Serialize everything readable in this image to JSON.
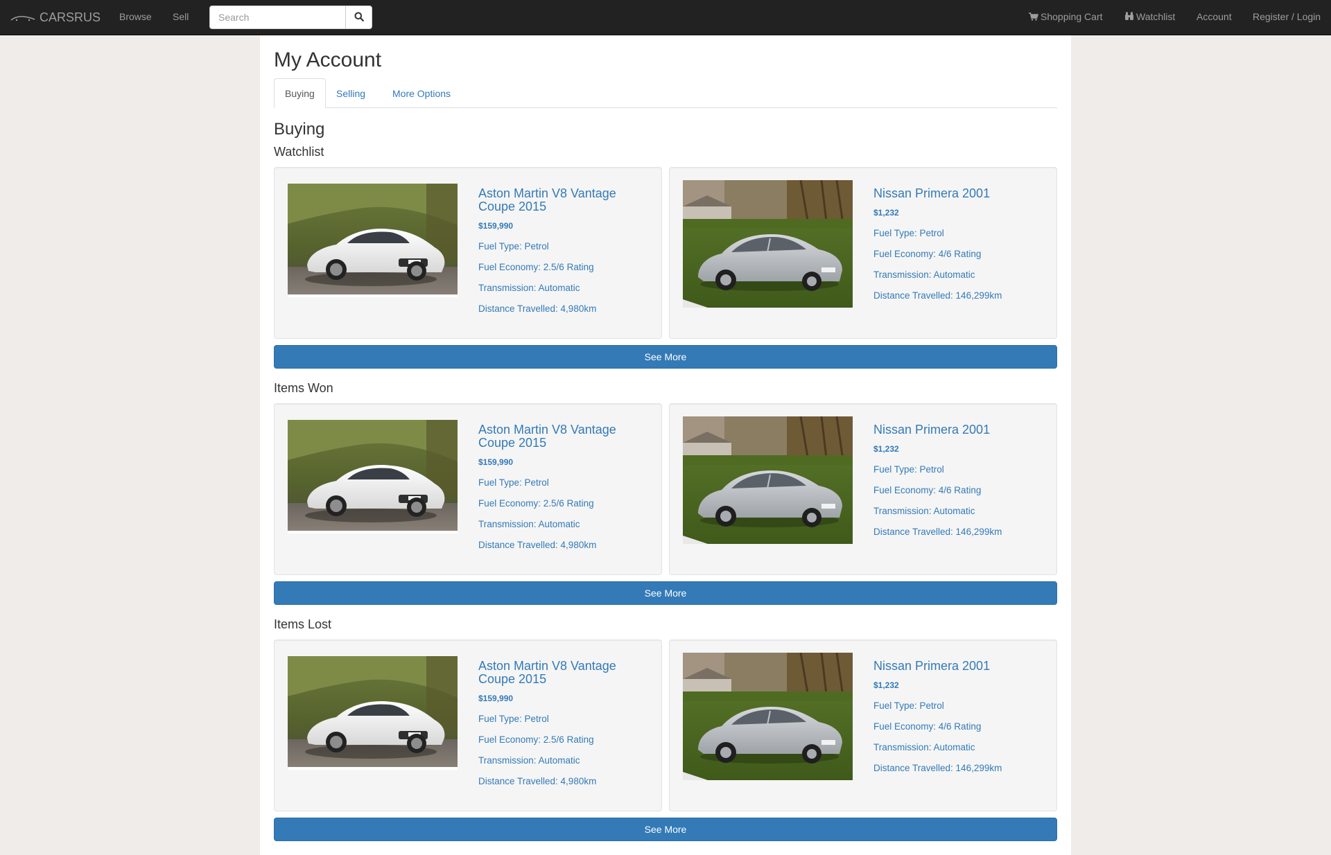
{
  "nav": {
    "brand": "CARSRUS",
    "browse": "Browse",
    "sell": "Sell",
    "search_placeholder": "Search",
    "shopping_cart": "Shopping Cart",
    "watchlist": "Watchlist",
    "account": "Account",
    "register_login": "Register / Login"
  },
  "page": {
    "title": "My Account",
    "tabs": [
      {
        "label": "Buying",
        "active": true
      },
      {
        "label": "Selling",
        "active": false
      },
      {
        "label": "More Options",
        "active": false
      }
    ],
    "section_heading": "Buying"
  },
  "sections": [
    {
      "heading": "Watchlist",
      "cards": [
        {
          "title": "Aston Martin V8 Vantage Coupe 2015",
          "price": "$159,990",
          "fuel_type": "Fuel Type: Petrol",
          "fuel_economy": "Fuel Economy: 2.5/6 Rating",
          "transmission": "Transmission: Automatic",
          "distance": "Distance Travelled: 4,980km",
          "image": "white-sports-car"
        },
        {
          "title": "Nissan Primera 2001",
          "price": "$1,232",
          "fuel_type": "Fuel Type: Petrol",
          "fuel_economy": "Fuel Economy: 4/6 Rating",
          "transmission": "Transmission: Automatic",
          "distance": "Distance Travelled: 146,299km",
          "image": "silver-sedan"
        }
      ],
      "button": "See More"
    },
    {
      "heading": "Items Won",
      "cards": [
        {
          "title": "Aston Martin V8 Vantage Coupe 2015",
          "price": "$159,990",
          "fuel_type": "Fuel Type: Petrol",
          "fuel_economy": "Fuel Economy: 2.5/6 Rating",
          "transmission": "Transmission: Automatic",
          "distance": "Distance Travelled: 4,980km",
          "image": "white-sports-car"
        },
        {
          "title": "Nissan Primera 2001",
          "price": "$1,232",
          "fuel_type": "Fuel Type: Petrol",
          "fuel_economy": "Fuel Economy: 4/6 Rating",
          "transmission": "Transmission: Automatic",
          "distance": "Distance Travelled: 146,299km",
          "image": "silver-sedan"
        }
      ],
      "button": "See More"
    },
    {
      "heading": "Items Lost",
      "cards": [
        {
          "title": "Aston Martin V8 Vantage Coupe 2015",
          "price": "$159,990",
          "fuel_type": "Fuel Type: Petrol",
          "fuel_economy": "Fuel Economy: 2.5/6 Rating",
          "transmission": "Transmission: Automatic",
          "distance": "Distance Travelled: 4,980km",
          "image": "white-sports-car"
        },
        {
          "title": "Nissan Primera 2001",
          "price": "$1,232",
          "fuel_type": "Fuel Type: Petrol",
          "fuel_economy": "Fuel Economy: 4/6 Rating",
          "transmission": "Transmission: Automatic",
          "distance": "Distance Travelled: 146,299km",
          "image": "silver-sedan"
        }
      ],
      "button": "See More"
    }
  ],
  "colors": {
    "navbar": "#222222",
    "link": "#337ab7",
    "button": "#337ab7",
    "page_bg": "#efecea"
  }
}
